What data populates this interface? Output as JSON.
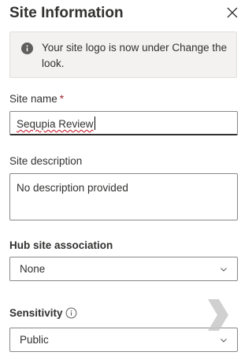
{
  "panel": {
    "title": "Site Information",
    "close_icon": "close-icon"
  },
  "info_bar": {
    "icon": "info-icon",
    "message": "Your site logo is now under Change the look."
  },
  "site_name": {
    "label": "Site name",
    "required_mark": "*",
    "value": "Sequpia Review"
  },
  "site_description": {
    "label": "Site description",
    "value": "No description provided"
  },
  "hub_site": {
    "label": "Hub site association",
    "selected": "None",
    "icon": "chevron-down-icon"
  },
  "sensitivity": {
    "label": "Sensitivity",
    "help_icon": "info-circle-icon",
    "selected": "Public",
    "icon": "chevron-down-icon"
  },
  "colors": {
    "required": "#a4262c",
    "info_bar_bg": "#f3f2f1",
    "border": "#8a8886",
    "text": "#323130"
  }
}
